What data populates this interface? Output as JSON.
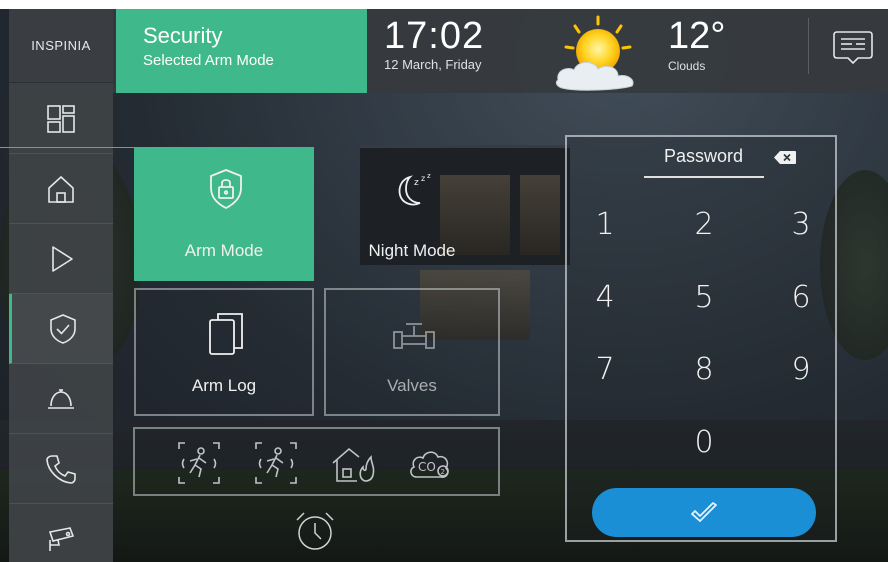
{
  "logo": {
    "text": "INSPINIA"
  },
  "header": {
    "title": "Security",
    "subtitle": "Selected Arm Mode",
    "time": "17:02",
    "date": "12 March, Friday",
    "temperature": "12°",
    "weather_condition": "Clouds",
    "weather_icon": "sun-cloud-icon"
  },
  "sidebar": {
    "items": [
      {
        "icon": "dashboard-icon"
      },
      {
        "icon": "home-icon"
      },
      {
        "icon": "play-icon"
      },
      {
        "icon": "shield-check-icon",
        "active": true
      },
      {
        "icon": "service-bell-icon"
      },
      {
        "icon": "phone-icon"
      },
      {
        "icon": "security-camera-icon"
      }
    ]
  },
  "modes": [
    {
      "label": "Arm Mode",
      "icon": "shield-lock-icon",
      "state": "selected"
    },
    {
      "label": "Night Mode",
      "icon": "moon-sleep-icon",
      "state": "normal"
    },
    {
      "label": "Arm Log",
      "icon": "copy-log-icon",
      "state": "normal"
    },
    {
      "label": "Valves",
      "icon": "valve-icon",
      "state": "disabled"
    }
  ],
  "sensors": [
    "motion-sensor-icon",
    "motion-sensor-icon",
    "house-fire-icon",
    "co2-icon"
  ],
  "keypad": {
    "password_label": "Password",
    "keys": [
      "1",
      "2",
      "3",
      "4",
      "5",
      "6",
      "7",
      "8",
      "9",
      "0"
    ]
  },
  "colors": {
    "accent_green": "#3fb98b",
    "confirm_blue": "#1a8fd6",
    "panel_dark": "#3a3e42"
  }
}
